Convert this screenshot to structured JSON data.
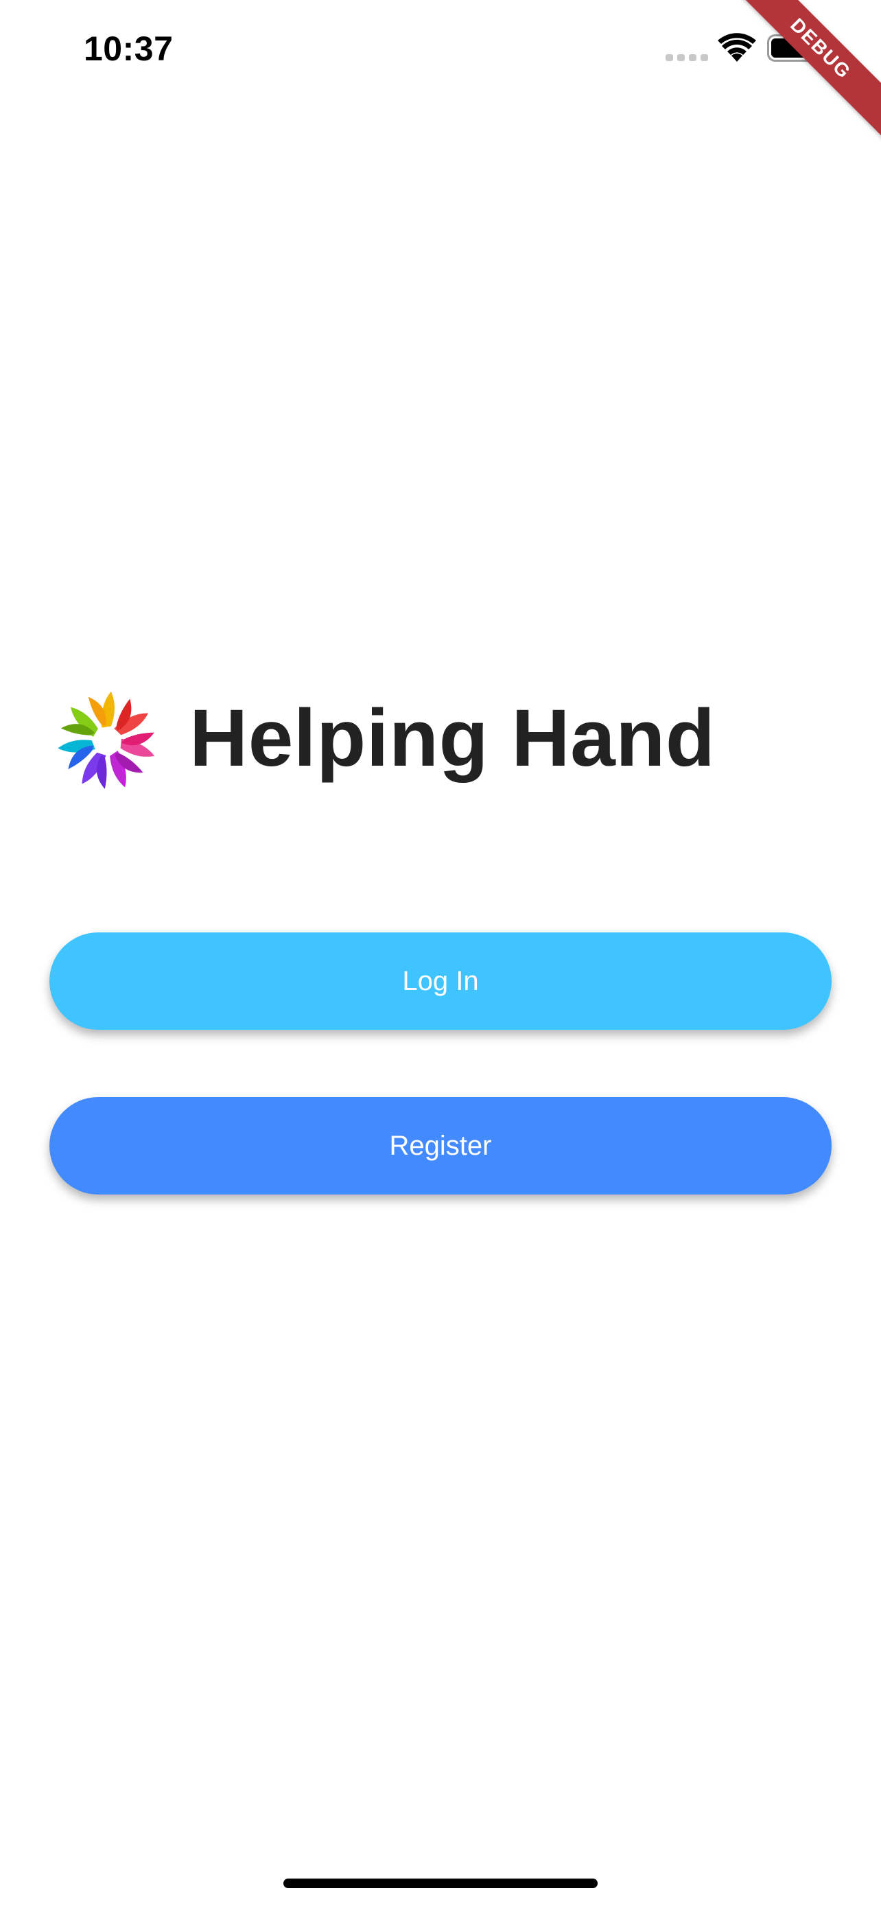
{
  "status_bar": {
    "time": "10:37",
    "icons": [
      "signal-icon",
      "wifi-icon",
      "battery-icon"
    ]
  },
  "debug_banner": {
    "label": "DEBUG",
    "color": "#b3353a"
  },
  "brand": {
    "logo_icon": "hands-circle-logo-icon",
    "title": "Helping Hand",
    "title_color": "#222222"
  },
  "actions": {
    "login_label": "Log In",
    "login_color": "#40c4ff",
    "register_label": "Register",
    "register_color": "#448aff"
  },
  "home_indicator": {
    "color": "#000000"
  }
}
